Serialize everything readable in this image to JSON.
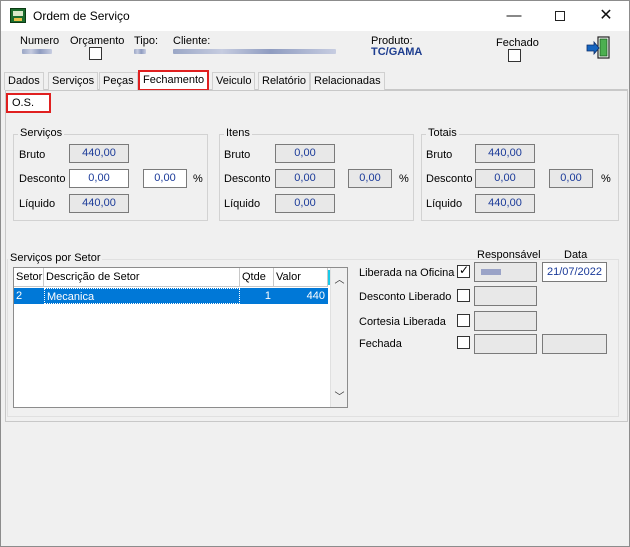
{
  "window": {
    "title": "Ordem de Serviço"
  },
  "header": {
    "numero_label": "Numero",
    "orcamento_label": "Orçamento",
    "tipo_label": "Tipo:",
    "cliente_label": "Cliente:",
    "produto_label": "Produto:",
    "produto_value": "TC/GAMA",
    "fechado_label": "Fechado"
  },
  "tabs": [
    "Dados",
    "Serviços",
    "Peças",
    "Fechamento",
    "Veiculo",
    "Relatório",
    "Relacionadas"
  ],
  "active_tab": "Fechamento",
  "subtab": "O.S.",
  "servicos": {
    "title": "Serviços",
    "bruto_label": "Bruto",
    "bruto": "440,00",
    "desconto_label": "Desconto",
    "desconto": "0,00",
    "desconto_pct": "0,00",
    "pct_symbol": "%",
    "liquido_label": "Líquido",
    "liquido": "440,00"
  },
  "itens": {
    "title": "Itens",
    "bruto_label": "Bruto",
    "bruto": "0,00",
    "desconto_label": "Desconto",
    "desconto": "0,00",
    "desconto_pct": "0,00",
    "pct_symbol": "%",
    "liquido_label": "Líquido",
    "liquido": "0,00"
  },
  "totais": {
    "title": "Totais",
    "bruto_label": "Bruto",
    "bruto": "440,00",
    "desconto_label": "Desconto",
    "desconto": "0,00",
    "desconto_pct": "0,00",
    "pct_symbol": "%",
    "liquido_label": "Líquido",
    "liquido": "440,00"
  },
  "setor": {
    "title": "Serviços por Setor",
    "columns": [
      "Setor",
      "Descrição de Setor",
      "Qtde",
      "Valor"
    ],
    "rows": [
      {
        "setor": "2",
        "descricao": "Mecanica",
        "qtde": "1",
        "valor": "440"
      }
    ]
  },
  "status": {
    "responsavel_header": "Responsável",
    "data_header": "Data",
    "liberada_label": "Liberada na Oficina",
    "liberada_checked": true,
    "liberada_data": "21/07/2022",
    "desconto_label": "Desconto Liberado",
    "cortesia_label": "Cortesia  Liberada",
    "fechada_label": "Fechada"
  },
  "icons": {
    "app": "app-icon",
    "exit": "exit-door-icon",
    "scroll_up": "chevron-up-icon",
    "scroll_down": "chevron-down-icon"
  },
  "colors": {
    "accent": "#0078d7",
    "value_text": "#1a3a99",
    "highlight_border": "#e02020"
  }
}
